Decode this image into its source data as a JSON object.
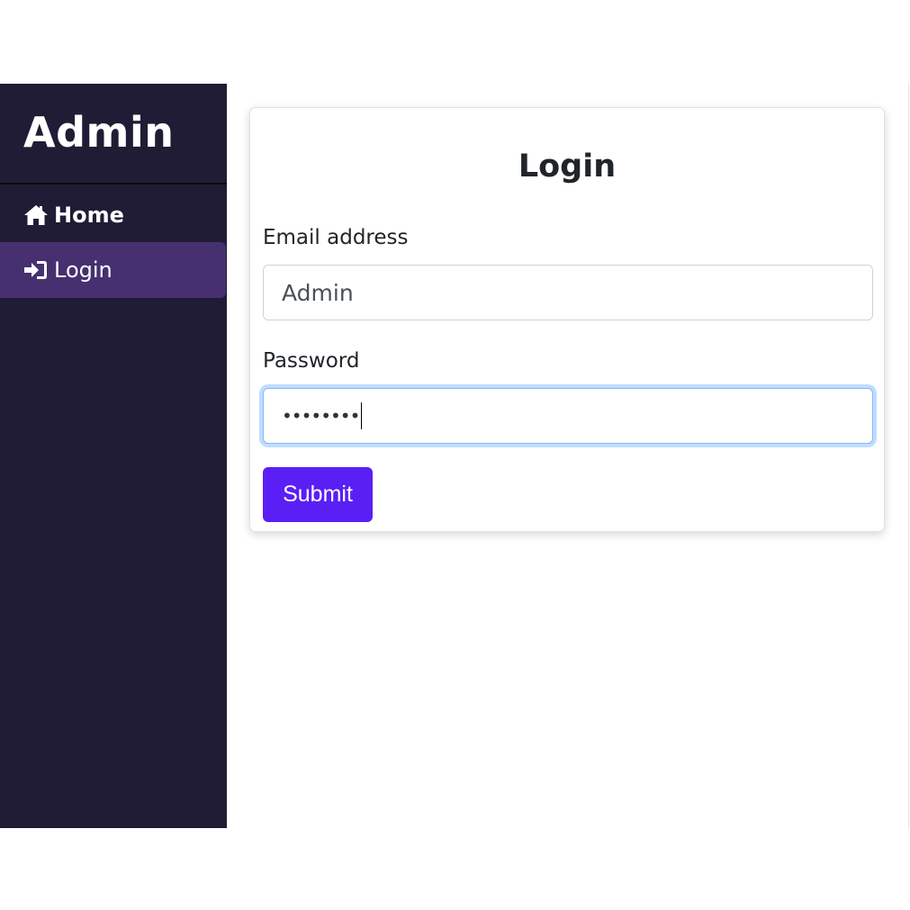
{
  "sidebar": {
    "brand": "Admin",
    "items": [
      {
        "label": "Home",
        "icon": "home-icon"
      },
      {
        "label": "Login",
        "icon": "sign-in-icon"
      }
    ],
    "active_item": "Login"
  },
  "form": {
    "title": "Login",
    "email": {
      "label": "Email address",
      "value": "Admin"
    },
    "password": {
      "label": "Password",
      "value": "••••••••"
    },
    "submit_label": "Submit"
  },
  "colors": {
    "sidebar_bg": "#201c35",
    "active_item_bg": "#47306f",
    "submit_bg": "#5a1ff5",
    "focus_border": "#86b7fe"
  }
}
